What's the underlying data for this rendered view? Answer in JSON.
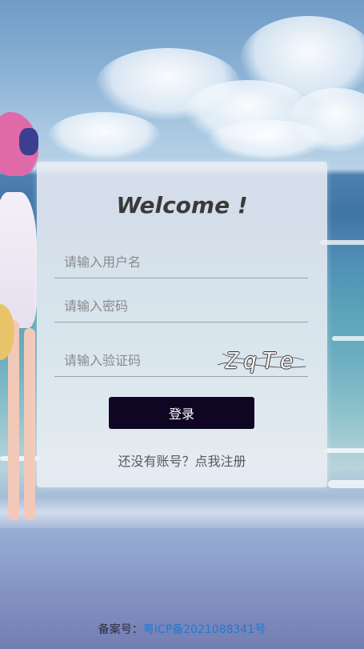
{
  "login": {
    "title": "Welcome !",
    "username_placeholder": "请输入用户名",
    "password_placeholder": "请输入密码",
    "captcha_placeholder": "请输入验证码",
    "captcha_text": "ZqTe",
    "login_button": "登录",
    "register_link": "还没有账号？点我注册"
  },
  "footer": {
    "record_label": "备案号：",
    "icp_number": "粤ICP备2021088341号"
  },
  "colors": {
    "button_bg": "#0e0622",
    "link": "#1f7ad0"
  }
}
